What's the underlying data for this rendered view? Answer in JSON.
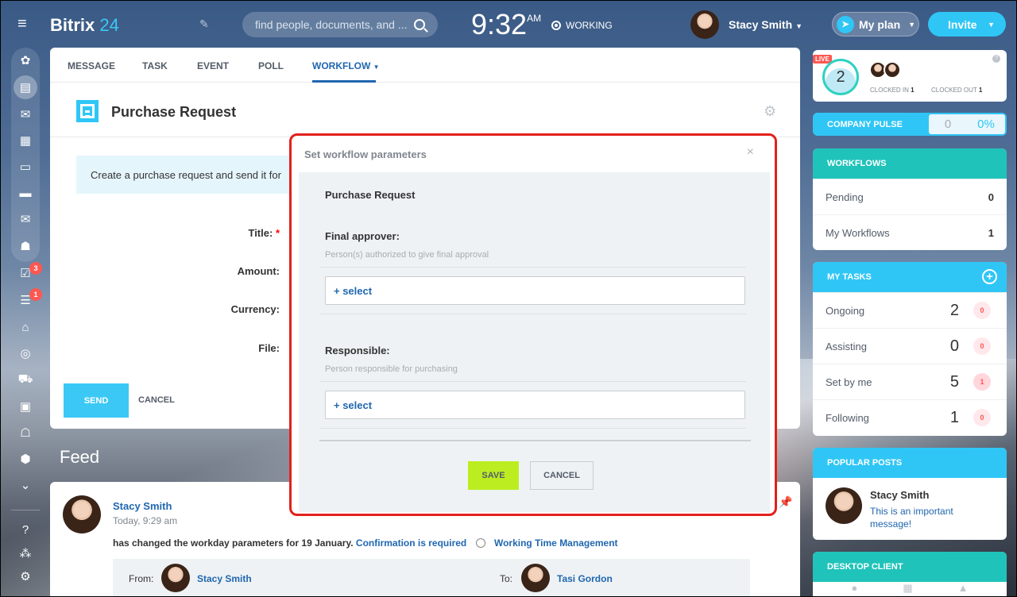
{
  "header": {
    "logo_main": "Bitrix",
    "logo_num": " 24",
    "search_placeholder": "find people, documents, and ...",
    "time": "9:32",
    "ampm": "AM",
    "status": "WORKING",
    "user_name": "Stacy Smith",
    "my_plan": "My plan",
    "invite": "Invite"
  },
  "leftbar": {
    "badges": {
      "tasks": "3",
      "filter": "1"
    }
  },
  "composer": {
    "tabs": [
      "MESSAGE",
      "TASK",
      "EVENT",
      "POLL",
      "WORKFLOW"
    ],
    "active_tab": "WORKFLOW",
    "title": "Purchase Request",
    "info_text": "Create a purchase request and send it for",
    "fields": {
      "title": "Title:",
      "required_mark": "*",
      "amount": "Amount:",
      "currency": "Currency:",
      "file": "File:"
    },
    "send": "SEND",
    "cancel": "CANCEL"
  },
  "feed": {
    "title": "Feed",
    "post": {
      "author": "Stacy Smith",
      "time": "Today, 9:29 am",
      "text": "has changed the workday parameters for 19 January.",
      "confirm_link": "Confirmation is required",
      "module_link": "Working Time Management",
      "from_label": "From:",
      "from_name": "Stacy Smith",
      "to_label": "To:",
      "to_name": "Tasi Gordon"
    }
  },
  "dialog": {
    "title": "Set workflow parameters",
    "close": "×",
    "heading": "Purchase Request",
    "final_approver_label": "Final approver:",
    "final_approver_desc": "Person(s) authorized to give final approval",
    "select1": "+ select",
    "responsible_label": "Responsible:",
    "responsible_desc": "Person responsible for purchasing",
    "select2": "+ select",
    "save": "SAVE",
    "cancel": "CANCEL"
  },
  "right": {
    "live": "LIVE",
    "clocked_count": "2",
    "clocked_in_label": "CLOCKED IN",
    "clocked_in_val": "1",
    "clocked_out_label": "CLOCKED OUT",
    "clocked_out_val": "1",
    "pulse_label": "COMPANY PULSE",
    "pulse_val": "0",
    "pulse_pct": "0%",
    "workflows_title": "WORKFLOWS",
    "workflows": [
      {
        "label": "Pending",
        "value": "0"
      },
      {
        "label": "My Workflows",
        "value": "1"
      }
    ],
    "tasks_title": "MY TASKS",
    "tasks": [
      {
        "label": "Ongoing",
        "value": "2",
        "count": "0"
      },
      {
        "label": "Assisting",
        "value": "0",
        "count": "0"
      },
      {
        "label": "Set by me",
        "value": "5",
        "count": "1"
      },
      {
        "label": "Following",
        "value": "1",
        "count": "0"
      }
    ],
    "popular_title": "POPULAR POSTS",
    "popular_author": "Stacy Smith",
    "popular_msg": "This is an important message!",
    "desktop_title": "DESKTOP CLIENT"
  },
  "colors": {
    "accent": "#2fc6f6",
    "link": "#2067b0",
    "workflows_header": "#20c3ba",
    "save_button": "#bbed21",
    "highlight_border": "#e3201b",
    "badge": "#ff5752"
  }
}
